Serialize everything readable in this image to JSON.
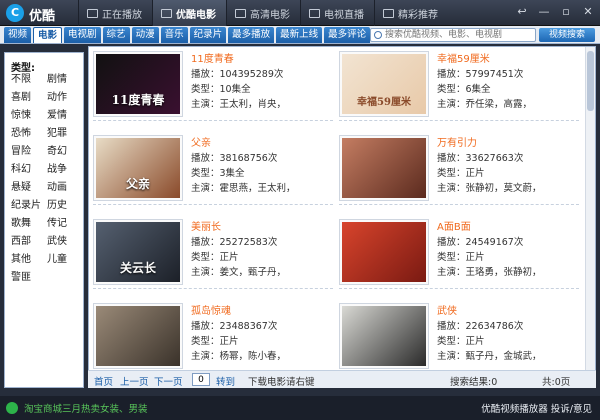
{
  "app": {
    "logo": "C",
    "name": "优酷"
  },
  "top_tabs": [
    {
      "label": "正在播放"
    },
    {
      "label": "优酷电影"
    },
    {
      "label": "高清电影"
    },
    {
      "label": "电视直播"
    },
    {
      "label": "精彩推荐"
    }
  ],
  "window_controls": {
    "back": "↩",
    "minimize": "—",
    "restore": "▫",
    "close": "✕"
  },
  "category_tabs": [
    "视频",
    "电影",
    "电视剧",
    "综艺",
    "动漫",
    "音乐",
    "纪录片",
    "最多播放",
    "最新上线",
    "最多评论"
  ],
  "search": {
    "placeholder": "搜索优酷视频、电影、电视剧",
    "button": "视频搜索"
  },
  "sidebar": {
    "title": "类型:",
    "genres": [
      "不限",
      "剧情",
      "喜剧",
      "动作",
      "惊悚",
      "爱情",
      "恐怖",
      "犯罪",
      "冒险",
      "奇幻",
      "科幻",
      "战争",
      "悬疑",
      "动画",
      "纪录片",
      "历史",
      "歌舞",
      "传记",
      "西部",
      "武侠",
      "其他",
      "儿童",
      "警匪"
    ]
  },
  "movies": [
    {
      "title": "11度青春",
      "plays": "播放：104395289次",
      "type": "类型：10集全",
      "cast": "主演：王太利，肖央，",
      "poster_text": "11度青春",
      "colors": [
        "#111111",
        "#3a1030"
      ]
    },
    {
      "title": "幸福59厘米",
      "plays": "播放：57997451次",
      "type": "类型：6集全",
      "cast": "主演：乔任梁，高露，",
      "poster_text": "幸福59厘米",
      "colors": [
        "#f2e4d2",
        "#e8c9a8"
      ]
    },
    {
      "title": "父亲",
      "plays": "播放：38168756次",
      "type": "类型：3集全",
      "cast": "主演：霍思燕，王太利，",
      "poster_text": "父亲",
      "colors": [
        "#e8dcc6",
        "#8a4a2a"
      ]
    },
    {
      "title": "万有引力",
      "plays": "播放：33627663次",
      "type": "类型：正片",
      "cast": "主演：张静初，莫文蔚，",
      "poster_text": "",
      "colors": [
        "#c47d62",
        "#5b2a1e"
      ]
    },
    {
      "title": "美丽长",
      "plays": "播放：25272583次",
      "type": "类型：正片",
      "cast": "主演：姜文，甄子丹，",
      "poster_text": "关云长",
      "colors": [
        "#556070",
        "#1c2028"
      ]
    },
    {
      "title": "A面B面",
      "plays": "播放：24549167次",
      "type": "类型：正片",
      "cast": "主演：王珞勇，张静初，",
      "poster_text": "",
      "colors": [
        "#d8442c",
        "#7a1a12"
      ]
    },
    {
      "title": "孤岛惊魂",
      "plays": "播放：23488367次",
      "type": "类型：正片",
      "cast": "主演：杨幂，陈小春，",
      "poster_text": "",
      "colors": [
        "#9a8a78",
        "#3a322a"
      ]
    },
    {
      "title": "武侠",
      "plays": "播放：22634786次",
      "type": "类型：正片",
      "cast": "主演：甄子丹，金城武，",
      "poster_text": "",
      "colors": [
        "#d9d9d4",
        "#2a2a2a"
      ]
    }
  ],
  "pager": {
    "first": "首页",
    "prev": "上一页",
    "next": "下一页",
    "page_value": "0",
    "goto": "转到",
    "download_hint": "下载电影请右键",
    "results": "搜索结果:0",
    "total": "共:0页"
  },
  "status": {
    "promo": "淘宝商城三月热卖女装、男装",
    "right": "优酷视频播放器  投诉/意见"
  },
  "colors": {
    "accent": "#1c5fa8",
    "title_orange": "#f06a1e",
    "promo_green": "#58c55a"
  }
}
